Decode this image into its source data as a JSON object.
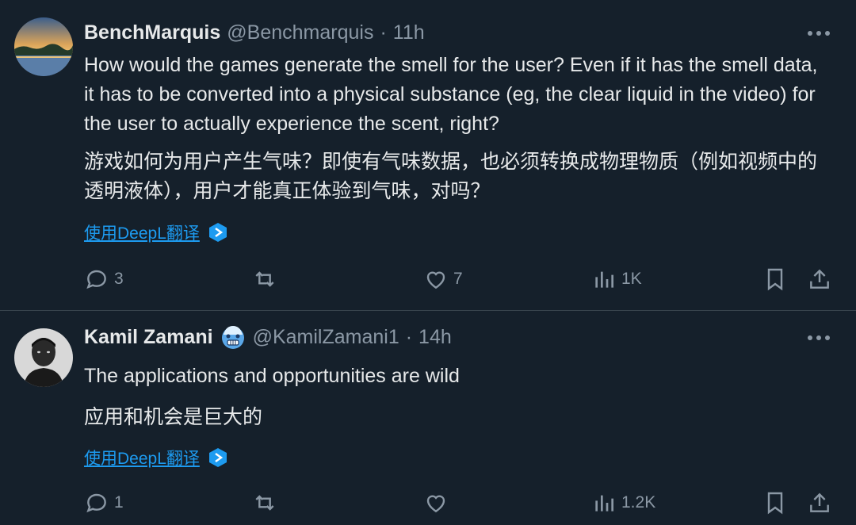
{
  "tweets": [
    {
      "name": "BenchMarquis",
      "handle": "@Benchmarquis",
      "separator": "·",
      "time": "11h",
      "text_en": "How would the games generate the smell for the user? Even if it has the smell data, it has to be converted into a physical substance (eg, the clear liquid in the video) for the user to actually experience the scent, right?",
      "text_zh": "游戏如何为用户产生气味？即使有气味数据，也必须转换成物理物质（例如视频中的透明液体），用户才能真正体验到气味，对吗？",
      "translate_label": "使用DeepL翻译",
      "replies": "3",
      "retweets": "",
      "likes": "7",
      "views": "1K",
      "avatar_icon": "landscape-avatar"
    },
    {
      "name": "Kamil Zamani",
      "handle": "@KamilZamani1",
      "separator": "·",
      "time": "14h",
      "text_en": "The applications and opportunities are wild",
      "text_zh": "应用和机会是巨大的",
      "translate_label": "使用DeepL翻译",
      "replies": "1",
      "retweets": "",
      "likes": "",
      "views": "1.2K",
      "avatar_icon": "portrait-avatar",
      "badge_icon": "cold-face-emoji"
    }
  ],
  "colors": {
    "background": "#15202b",
    "text": "#e7e9ea",
    "muted": "#8b98a5",
    "link": "#1d9bf0",
    "divider": "#38444d"
  }
}
